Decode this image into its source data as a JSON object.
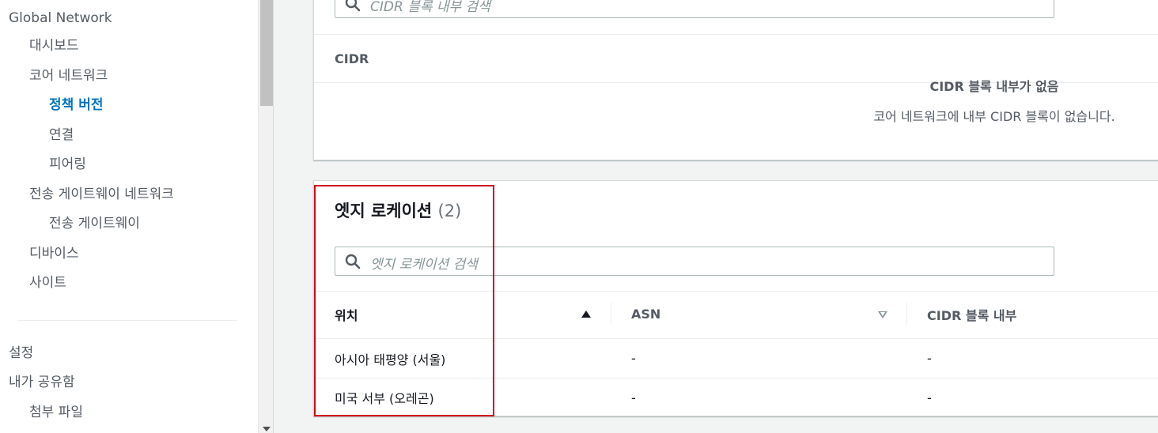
{
  "sidebar": {
    "items": [
      {
        "label": "Global Network"
      },
      {
        "label": "대시보드"
      },
      {
        "label": "코어 네트워크"
      },
      {
        "label": "정책 버전"
      },
      {
        "label": "연결"
      },
      {
        "label": "피어링"
      },
      {
        "label": "전송 게이트웨이 네트워크"
      },
      {
        "label": "전송 게이트웨이"
      },
      {
        "label": "디바이스"
      },
      {
        "label": "사이트"
      },
      {
        "label": "설정"
      },
      {
        "label": "내가 공유함"
      },
      {
        "label": "첨부 파일"
      }
    ]
  },
  "cidr_panel": {
    "search_placeholder": "CIDR 블록 내부 검색",
    "column": "CIDR",
    "empty_title": "CIDR 블록 내부가 없음",
    "empty_desc": "코어 네트워크에 내부 CIDR 블록이 없습니다."
  },
  "edge_panel": {
    "title": "엣지 로케이션",
    "count": "(2)",
    "search_placeholder": "엣지 로케이션 검색",
    "columns": [
      "위치",
      "ASN",
      "CIDR 블록 내부"
    ],
    "rows": [
      [
        "아시아 태평양 (서울)",
        "-",
        "-"
      ],
      [
        "미국 서부 (오레곤)",
        "-",
        "-"
      ]
    ]
  },
  "colors": {
    "accent": "#0073bb",
    "highlight": "#d0021b"
  }
}
